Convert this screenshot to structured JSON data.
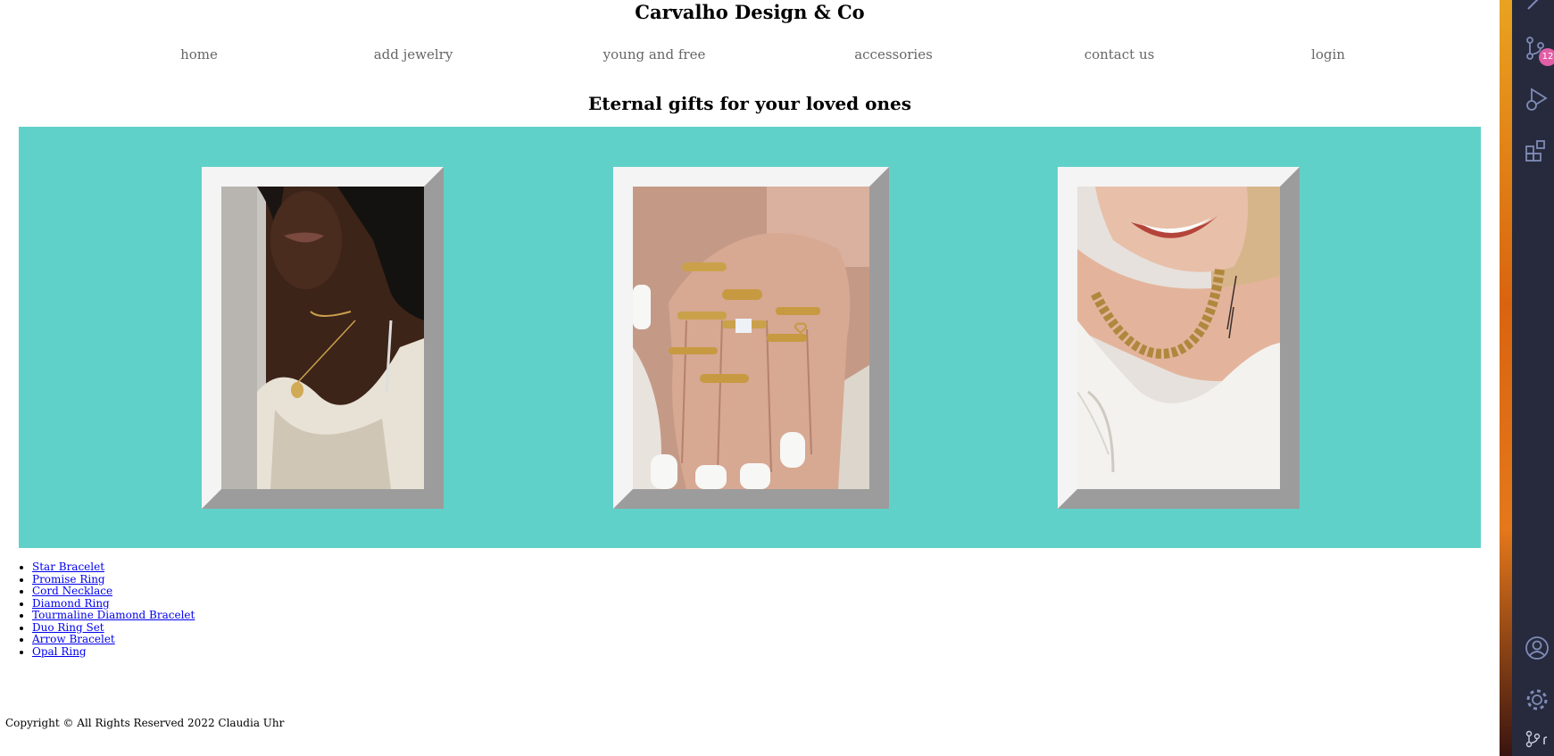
{
  "site": {
    "title": "Carvalho Design & Co"
  },
  "nav": {
    "items": [
      {
        "label": "home"
      },
      {
        "label": "add jewelry"
      },
      {
        "label": "young and free"
      },
      {
        "label": "accessories"
      },
      {
        "label": "contact us"
      },
      {
        "label": "login"
      }
    ]
  },
  "hero": {
    "heading": "Eternal gifts for your loved ones",
    "background_color": "#60d1c9"
  },
  "gallery": {
    "frame_color_light": "#f4f4f4",
    "frame_color_dark": "#9c9c9c"
  },
  "products": {
    "items": [
      {
        "label": "Star Bracelet"
      },
      {
        "label": "Promise Ring"
      },
      {
        "label": "Cord Necklace"
      },
      {
        "label": "Diamond Ring"
      },
      {
        "label": "Tourmaline Diamond Bracelet"
      },
      {
        "label": "Duo Ring Set"
      },
      {
        "label": "Arrow Bracelet"
      },
      {
        "label": "Opal Ring"
      }
    ]
  },
  "footer": {
    "copyright": "Copyright © All Rights Reserved 2022 Claudia Uhr"
  },
  "editor_sidebar": {
    "source_control_badge": "12",
    "icons": [
      "source-control-icon",
      "run-debug-icon",
      "extensions-icon",
      "account-icon",
      "settings-icon",
      "branch-icon"
    ]
  }
}
